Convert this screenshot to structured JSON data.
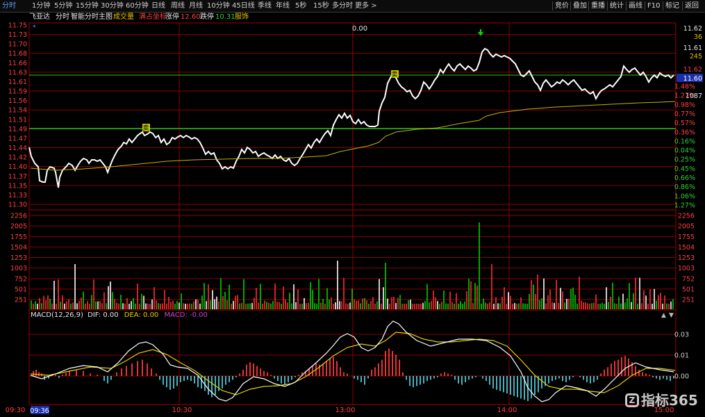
{
  "toolbar": {
    "tabs": [
      "分时",
      "1分钟",
      "5分钟",
      "15分钟",
      "30分钟",
      "60分钟",
      "日线",
      "周线",
      "月线",
      "10分钟",
      "45日线",
      "季线",
      "年线",
      "5秒",
      "15秒",
      "多分时",
      "更多 >"
    ],
    "active_tab": "分时",
    "right_buttons": [
      "竞价",
      "叠加",
      "重播",
      "统计",
      "画线",
      "F10",
      "标记",
      "返回"
    ]
  },
  "title_bar": {
    "stock_name": "飞亚达",
    "mode": "分时",
    "chart_name": "智能分时主图",
    "volume_label": "成交量",
    "coord_label": "满占坐标",
    "limit_up_label": "涨停",
    "limit_up_value": "12.60",
    "limit_down_label": "跌停",
    "limit_down_value": "10.31",
    "sector": "服饰"
  },
  "price_axis_labels": [
    "11.75",
    "11.73",
    "11.70",
    "11.68",
    "11.66",
    "11.63",
    "11.61",
    "11.59",
    "11.56",
    "11.54",
    "11.51",
    "11.49",
    "11.47",
    "11.44",
    "11.42",
    "11.40",
    "11.37",
    "11.35",
    "11.33",
    "11.30"
  ],
  "pct_axis_labels": [
    "1.48%",
    "1.27%",
    "0.98%",
    "0.77%",
    "0.57%",
    "0.36%",
    "0.16%",
    "0.04%",
    "0.25%",
    "0.45%",
    "0.66%",
    "0.86%",
    "1.06%",
    "1.27%"
  ],
  "volume_axis_labels": [
    "2256",
    "2005",
    "1755",
    "1504",
    "1253",
    "1003",
    "752",
    "501",
    "251"
  ],
  "right_info": {
    "price_1": "11.62",
    "count_1": "36",
    "price_2": "11.61",
    "count_2": "245",
    "price_3": "11.62",
    "current_price": "11.60",
    "volume_now": "1087"
  },
  "center_marker": "0.00",
  "sell_marker": "卖",
  "macd_bar": {
    "name": "MACD(12,26,9)",
    "dif_label": "DIF:",
    "dif_value": "0.00",
    "dea_label": "DEA:",
    "dea_value": "0.00",
    "macd_label": "MACD:",
    "macd_value": "-0.00"
  },
  "macd_axis_labels": [
    "0.03",
    "0.01",
    "0.00"
  ],
  "time_labels": [
    "09:30",
    "10:30",
    "13:00",
    "14:00",
    "15:00"
  ],
  "cursor_time": "09:36",
  "watermark": "指标365",
  "colors": {
    "up": "#ff3030",
    "down": "#00d200",
    "price_line": "#ffffff",
    "avg_line": "#c8b400",
    "grid": "#8a0000",
    "dif": "#ffffff",
    "dea": "#e6d200",
    "macd_pos": "#ff3a3a",
    "macd_neg": "#4fc9d8"
  },
  "chart_data": {
    "type": "line",
    "x": [
      "09:30",
      "10:30",
      "13:00",
      "14:00",
      "15:00"
    ],
    "series": [],
    "price_ylim": [
      11.3,
      11.75
    ],
    "avg_price_ylim": [
      11.3,
      11.75
    ],
    "key_prices": {
      "open": 11.44,
      "low": 11.34,
      "high": 11.69,
      "close": 11.6,
      "support_line": 11.49,
      "resistance_line": 11.62
    },
    "volume_ylim": [
      0,
      2256
    ],
    "macd_ylim": [
      -0.015,
      0.035
    ]
  }
}
